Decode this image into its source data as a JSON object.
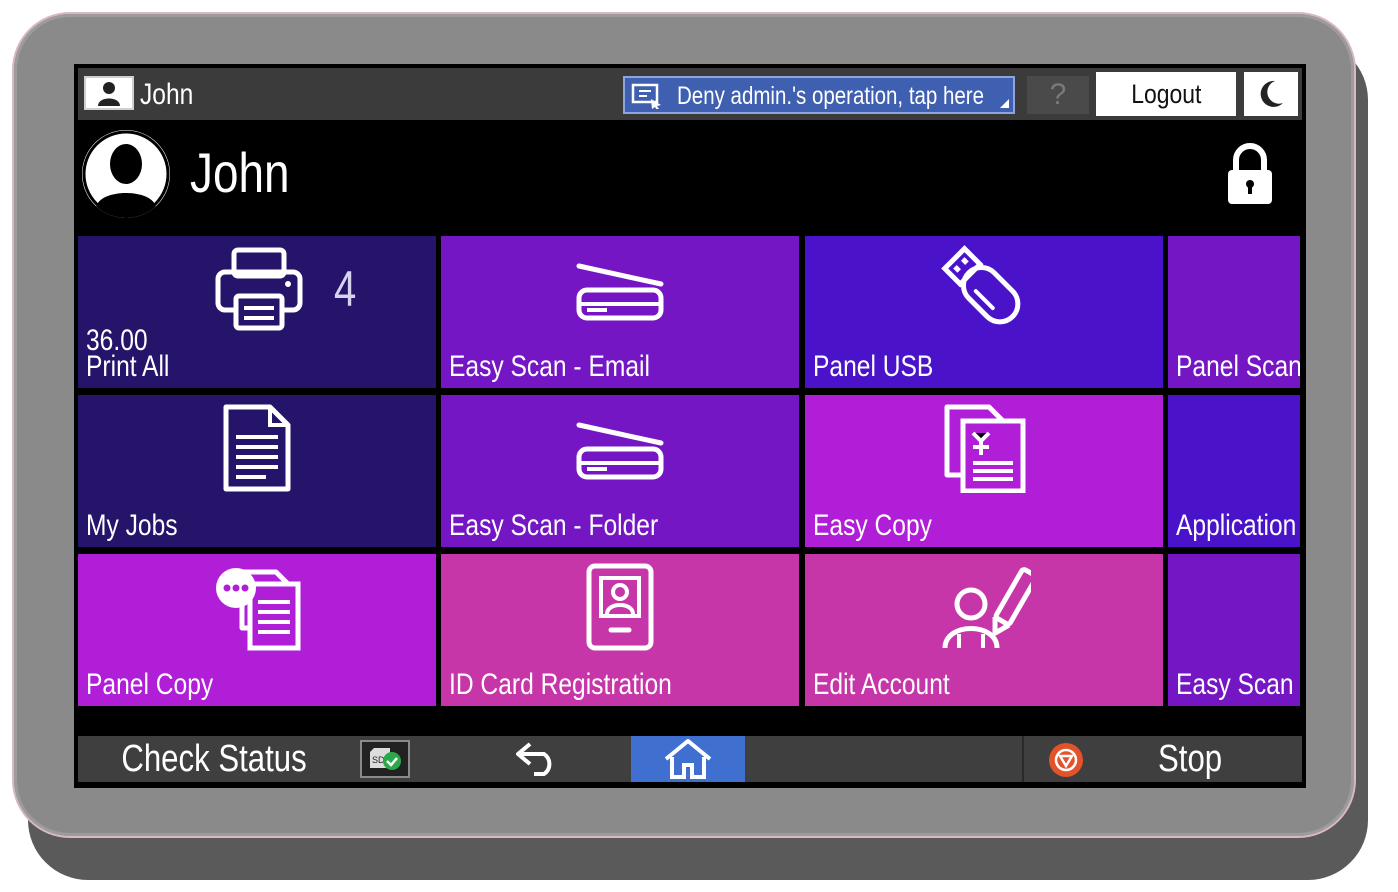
{
  "topbar": {
    "user_name": "John",
    "deny_button_label": "Deny admin.'s operation, tap here",
    "help_label": "?",
    "logout_label": "Logout"
  },
  "header": {
    "user_name": "John"
  },
  "tiles": [
    {
      "label": "Print All",
      "value": "36.00",
      "count": "4",
      "color": "#26136a",
      "icon": "printer-icon"
    },
    {
      "label": "Easy Scan - Email",
      "color": "#7516c4",
      "icon": "scanner-icon"
    },
    {
      "label": "Panel USB",
      "color": "#4a12c9",
      "icon": "usb-drive-icon"
    },
    {
      "label": "Panel Scan",
      "color": "#7516c4"
    },
    {
      "label": "My Jobs",
      "color": "#26136a",
      "icon": "document-icon"
    },
    {
      "label": "Easy Scan - Folder",
      "color": "#7516c4",
      "icon": "scanner-icon"
    },
    {
      "label": "Easy Copy",
      "color": "#b01ed8",
      "icon": "copy-documents-icon"
    },
    {
      "label": "Application L",
      "color": "#4a12c9"
    },
    {
      "label": "Panel Copy",
      "color": "#b01ed8",
      "icon": "copy-chat-icon"
    },
    {
      "label": "ID Card Registration",
      "color": "#c636a8",
      "icon": "id-card-icon"
    },
    {
      "label": "Edit Account",
      "color": "#c636a8",
      "icon": "edit-account-icon"
    },
    {
      "label": "Easy Scan wi",
      "color": "#7516c4"
    }
  ],
  "bottombar": {
    "check_status_label": "Check Status",
    "stop_label": "Stop"
  }
}
